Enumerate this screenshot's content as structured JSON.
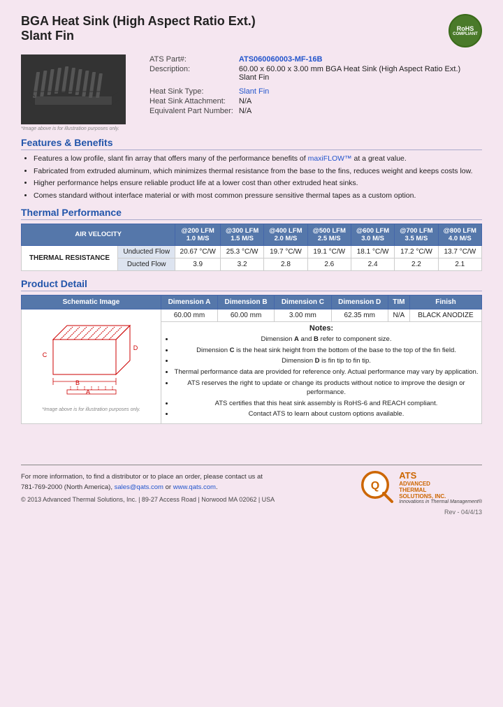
{
  "header": {
    "title_line1": "BGA Heat Sink (High Aspect Ratio Ext.)",
    "title_line2": "Slant Fin",
    "rohs": "RoHS\nCOMPLIANT"
  },
  "product": {
    "part_label": "ATS Part#:",
    "part_number": "ATS060060003-MF-16B",
    "description_label": "Description:",
    "description": "60.00 x 60.00 x 3.00 mm  BGA Heat Sink (High Aspect Ratio Ext.) Slant Fin",
    "type_label": "Heat Sink Type:",
    "type_value": "Slant Fin",
    "attachment_label": "Heat Sink Attachment:",
    "attachment_value": "N/A",
    "equiv_label": "Equivalent Part Number:",
    "equiv_value": "N/A",
    "image_note": "*Image above is for illustration purposes only."
  },
  "features": {
    "heading": "Features & Benefits",
    "items": [
      "Features a low profile, slant fin array that offers many of the performance benefits of maxiFLOW™ at a great value.",
      "Fabricated from extruded aluminum, which minimizes thermal resistance from the base to the fins, reduces weight and keeps costs low.",
      "Higher performance helps ensure reliable product life at a lower cost than other extruded heat sinks.",
      "Comes standard without interface material or with most common pressure sensitive thermal tapes as a custom option."
    ]
  },
  "thermal": {
    "heading": "Thermal Performance",
    "col_header": "AIR VELOCITY",
    "columns": [
      "@200 LFM\n1.0 M/S",
      "@300 LFM\n1.5 M/S",
      "@400 LFM\n2.0 M/S",
      "@500 LFM\n2.5 M/S",
      "@600 LFM\n3.0 M/S",
      "@700 LFM\n3.5 M/S",
      "@800 LFM\n4.0 M/S"
    ],
    "row_label": "THERMAL RESISTANCE",
    "rows": [
      {
        "label": "Unducted Flow",
        "values": [
          "20.67 °C/W",
          "25.3 °C/W",
          "19.7 °C/W",
          "19.1 °C/W",
          "18.1 °C/W",
          "17.2 °C/W",
          "13.7 °C/W"
        ]
      },
      {
        "label": "Ducted Flow",
        "values": [
          "3.9",
          "3.2",
          "2.8",
          "2.6",
          "2.4",
          "2.2",
          "2.1"
        ]
      }
    ]
  },
  "product_detail": {
    "heading": "Product Detail",
    "columns": [
      "Schematic Image",
      "Dimension A",
      "Dimension B",
      "Dimension C",
      "Dimension D",
      "TIM",
      "Finish"
    ],
    "values": [
      "60.00 mm",
      "60.00 mm",
      "3.00 mm",
      "62.35 mm",
      "N/A",
      "BLACK ANODIZE"
    ],
    "notes_heading": "Notes:",
    "notes": [
      "Dimension A and B refer to component size.",
      "Dimension C is the heat sink height from the bottom of the base to the top of the fin field.",
      "Dimension D is fin tip to fin tip.",
      "Thermal performance data are provided for reference only. Actual performance may vary by application.",
      "ATS reserves the right to update or change its products without notice to improve the design or performance.",
      "ATS certifies that this heat sink assembly is RoHS-6 and REACH compliant.",
      "Contact ATS to learn about custom options available."
    ],
    "schematic_note": "*Image above is for illustration purposes only."
  },
  "footer": {
    "contact_text": "For more information, to find a distributor or to place an order, please contact us at",
    "phone": "781-769-2000 (North America),",
    "email": "sales@qats.com",
    "or": " or ",
    "website": "www.qats.com",
    "period": ".",
    "copyright": "© 2013 Advanced Thermal Solutions, Inc.  |  89-27 Access Road  |  Norwood MA  02062  |  USA",
    "ats_name": "ATS",
    "ats_full1": "ADVANCED",
    "ats_full2": "THERMAL",
    "ats_full3": "SOLUTIONS, INC.",
    "ats_tagline": "Innovations in Thermal Management®",
    "page_num": "Rev - 04/4/13"
  }
}
